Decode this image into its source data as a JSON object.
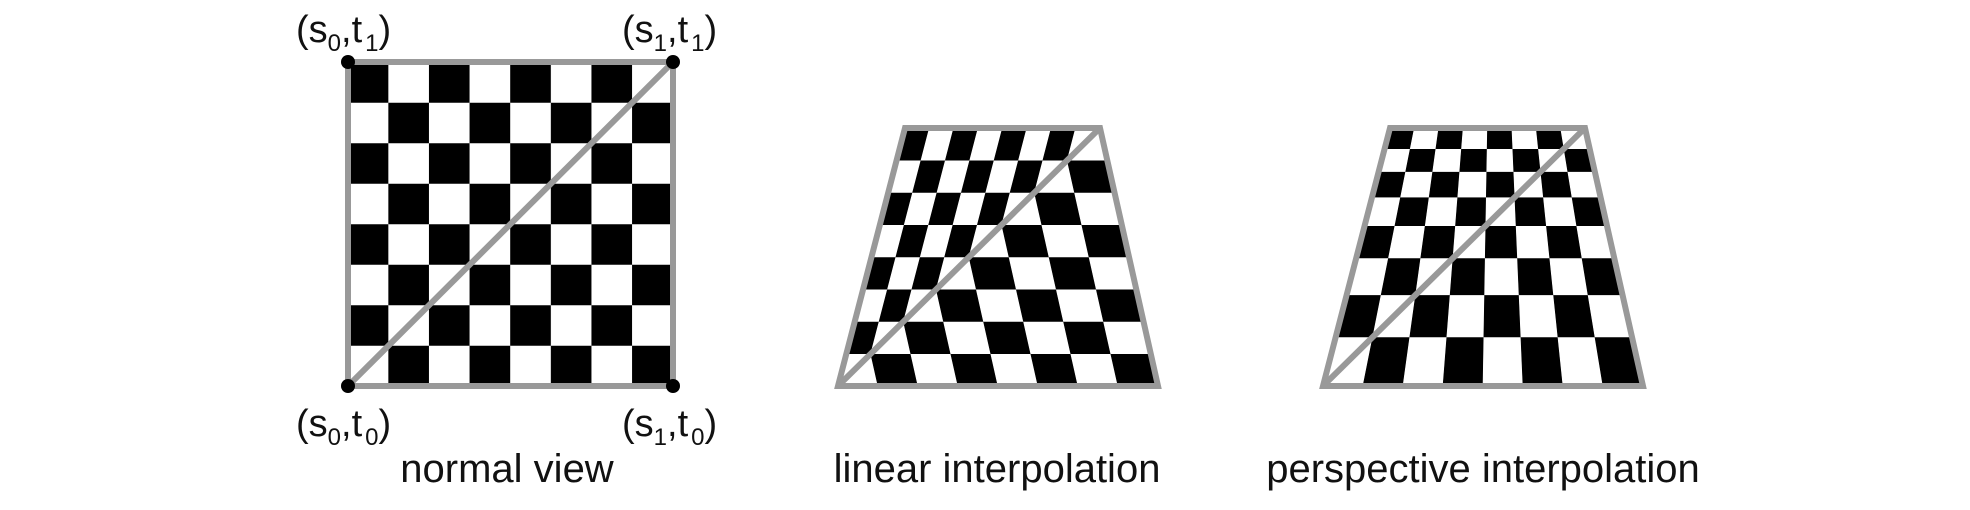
{
  "figure": {
    "captions": {
      "normal": "normal view",
      "linear": "linear interpolation",
      "perspective": "perspective interpolation"
    },
    "corners": {
      "top_left": {
        "s": "s",
        "s_sub": "0",
        "t": "t",
        "t_sub": "1"
      },
      "top_right": {
        "s": "s",
        "s_sub": "1",
        "t": "t",
        "t_sub": "1"
      },
      "bottom_left": {
        "s": "s",
        "s_sub": "0",
        "t": "t",
        "t_sub": "0"
      },
      "bottom_right": {
        "s": "s",
        "s_sub": "1",
        "t": "t",
        "t_sub": "0"
      }
    },
    "checker_cells": 8,
    "colors": {
      "border": "#999999",
      "dark": "#000000",
      "light": "#ffffff",
      "diagonal": "#999999",
      "corner_dot": "#000000"
    }
  }
}
